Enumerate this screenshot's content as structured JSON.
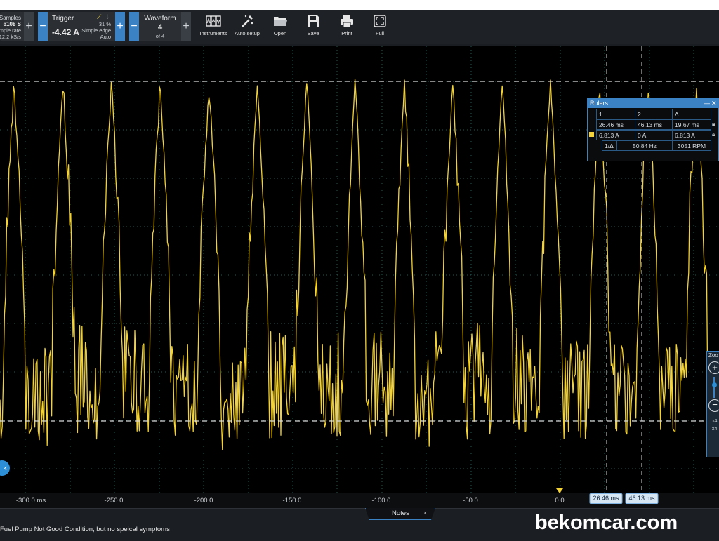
{
  "samples": {
    "label": "Samples",
    "value": "6108 S",
    "rate_label": "mple rate",
    "rate_value": "12.2 kS/s"
  },
  "trigger": {
    "label": "Trigger",
    "value": "-4.42 A",
    "percent": "31 %",
    "mode": "Simple edge",
    "auto": "Auto"
  },
  "waveform": {
    "label": "Waveform",
    "value": "4",
    "of": "of 4"
  },
  "tools": [
    {
      "label": "Instruments",
      "icon": "instruments-icon"
    },
    {
      "label": "Auto setup",
      "icon": "magic-wand-icon"
    },
    {
      "label": "Open",
      "icon": "folder-icon"
    },
    {
      "label": "Save",
      "icon": "save-icon"
    },
    {
      "label": "Print",
      "icon": "printer-icon"
    },
    {
      "label": "Full",
      "icon": "fullscreen-icon"
    }
  ],
  "rulers": {
    "title": "Rulers",
    "col1": "1",
    "col2": "2",
    "col_delta": "Δ",
    "time": {
      "r1": "26.46 ms",
      "r2": "46.13 ms",
      "delta": "19.67 ms"
    },
    "amp": {
      "r1": "6.813 A",
      "r2": "0 A",
      "delta": "6.813 A"
    },
    "freq": {
      "label": "1/Δ",
      "hz": "50.84 Hz",
      "rpm": "3051 RPM"
    }
  },
  "xaxis": {
    "ticks": [
      "-300.0 ms",
      "-250.0",
      "-200.0",
      "-150.0",
      "-100.0",
      "-50.0",
      "0.0"
    ],
    "ruler_tags": [
      "26.46 ms",
      "46.13 ms"
    ]
  },
  "zoom": {
    "label": "Zoo",
    "level1": "x4",
    "level2": "x4"
  },
  "notes": {
    "tab": "Notes",
    "close": "×",
    "text": "Fuel Pump Not Good Condition, but no speical symptoms"
  },
  "watermark": "bekomcar.com",
  "colors": {
    "trace": "#f3d237",
    "accent": "#3b82c4",
    "background": "#000000"
  }
}
